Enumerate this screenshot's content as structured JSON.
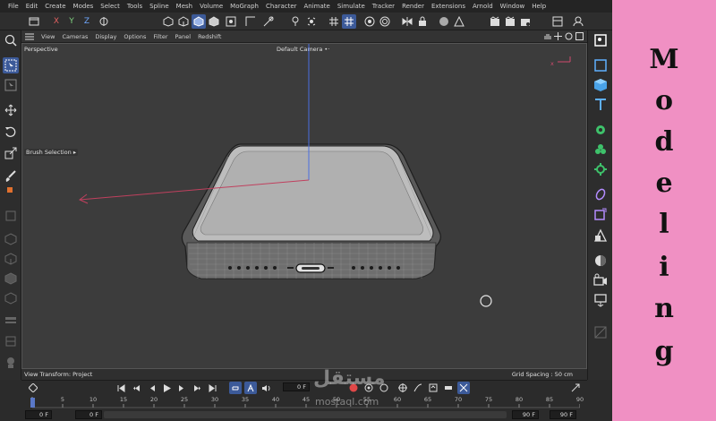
{
  "menu": [
    "File",
    "Edit",
    "Create",
    "Modes",
    "Select",
    "Tools",
    "Spline",
    "Mesh",
    "Volume",
    "MoGraph",
    "Character",
    "Animate",
    "Simulate",
    "Tracker",
    "Render",
    "Extensions",
    "Arnold",
    "Window",
    "Help"
  ],
  "toolbar": {
    "axis_x": "X",
    "axis_y": "Y",
    "axis_z": "Z"
  },
  "viewport_menu": [
    "View",
    "Cameras",
    "Display",
    "Options",
    "Filter",
    "Panel",
    "Redshift"
  ],
  "viewport": {
    "projection_label": "Perspective",
    "camera_label": "Default Camera",
    "camera_glyph": "•·",
    "tool_label": "Brush Selection",
    "tool_glyph": "▸",
    "axis_x_label": "x",
    "view_transform": "View Transform: Project",
    "grid_spacing": "Grid Spacing : 50 cm"
  },
  "timeline": {
    "current_frame": "0 F",
    "start_frame": "0 F",
    "min_frame": "0 F",
    "max_frame": "90 F",
    "end_frame": "90 F",
    "ticks": [
      "0",
      "5",
      "10",
      "15",
      "20",
      "25",
      "30",
      "35",
      "40",
      "45",
      "50",
      "55",
      "60",
      "65",
      "70",
      "75",
      "80",
      "85",
      "90"
    ]
  },
  "sidebar": {
    "letters": [
      "M",
      "o",
      "d",
      "e",
      "l",
      "i",
      "n",
      "g"
    ]
  },
  "watermark": {
    "logo_text": "مستقل",
    "url": "mostaql.com"
  },
  "colors": {
    "accent": "#3c5a99",
    "sidebar_bg": "#f090c3",
    "viewport_bg": "#3c3c3c"
  }
}
